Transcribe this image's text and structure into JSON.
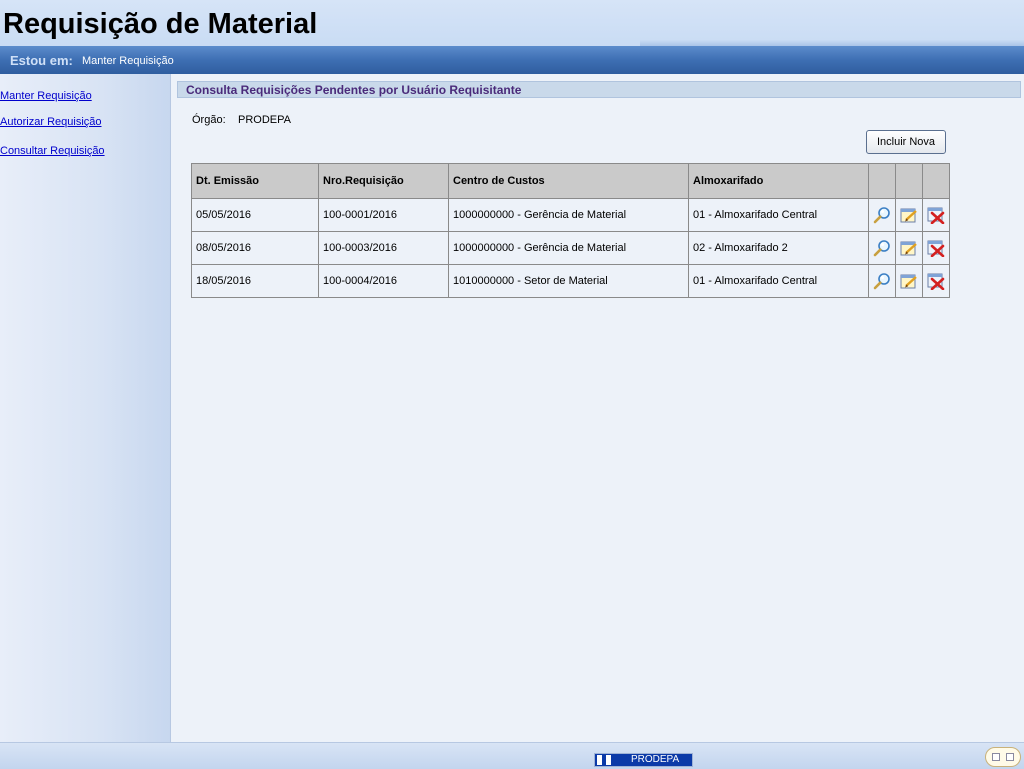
{
  "app": {
    "title": "Requisição de Material"
  },
  "breadcrumb": {
    "label": "Estou em:",
    "current": "Manter Requisição"
  },
  "sidebar": {
    "items": [
      {
        "label": "Manter Requisição"
      },
      {
        "label": "Autorizar Requisição"
      },
      {
        "label": "Consultar Requisição"
      }
    ]
  },
  "main": {
    "section_title": "Consulta Requisições Pendentes por Usuário Requisitante",
    "org_label": "Órgão:",
    "org_value": "PRODEPA",
    "new_button": "Incluir Nova",
    "table": {
      "headers": [
        "Dt. Emissão",
        "Nro.Requisição",
        "Centro de Custos",
        "Almoxarifado"
      ],
      "rows": [
        {
          "date": "05/05/2016",
          "number": "100-0001/2016",
          "cost_center": "1000000000 - Gerência de Material",
          "warehouse": "01 - Almoxarifado Central"
        },
        {
          "date": "08/05/2016",
          "number": "100-0003/2016",
          "cost_center": "1000000000 - Gerência de Material",
          "warehouse": "02 - Almoxarifado 2"
        },
        {
          "date": "18/05/2016",
          "number": "100-0004/2016",
          "cost_center": "1010000000 - Setor de Material",
          "warehouse": "01 - Almoxarifado Central"
        }
      ],
      "row_actions": [
        "search-icon",
        "edit-icon",
        "delete-icon"
      ]
    }
  },
  "footer": {
    "logo_text": "PRODEPA"
  },
  "colors": {
    "title_purple": "#4a2a7a",
    "link_blue": "#0000cc",
    "bar_blue": "#3e6fb3"
  }
}
